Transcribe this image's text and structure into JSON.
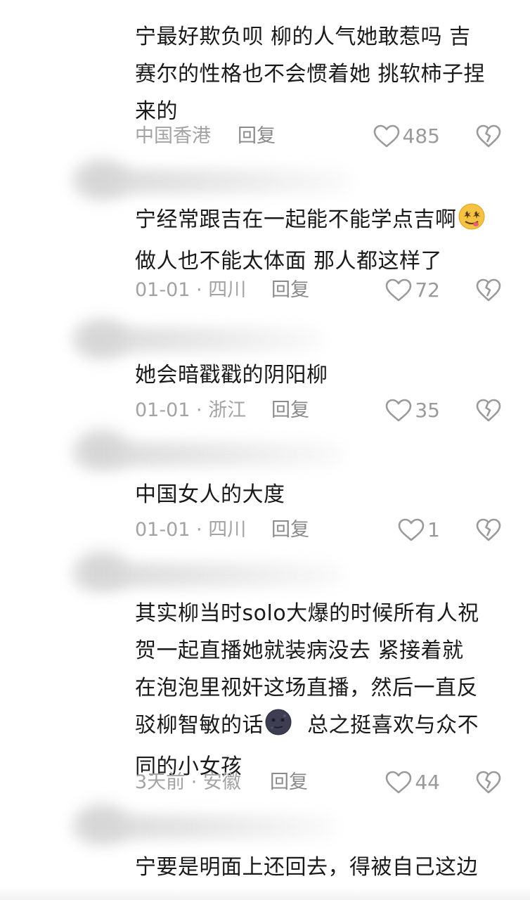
{
  "comments": [
    {
      "lines": [
        "宁最好欺负呗 柳的人气她敢惹吗 吉",
        "赛尔的性格也不会惯着她 挑软柿子捏",
        "来的"
      ],
      "meta": "中国香港",
      "reply": "回复",
      "likes": "485"
    },
    {
      "lines": [
        "宁经常跟吉在一起能不能学点吉啊",
        "做人也不能太体面 那人都这样了"
      ],
      "emoji": "drooling-face-icon",
      "meta": "01-01 · 四川",
      "reply": "回复",
      "likes": "72"
    },
    {
      "lines": [
        "她会暗戳戳的阴阳柳"
      ],
      "meta": "01-01 · 浙江",
      "reply": "回复",
      "likes": "35"
    },
    {
      "lines": [
        "中国女人的大度"
      ],
      "meta": "01-01 · 四川",
      "reply": "回复",
      "likes": "1"
    },
    {
      "lines": [
        "其实柳当时solo大爆的时候所有人祝",
        "贺一起直播她就装病没去  紧接着就",
        "在泡泡里视奸这场直播，然后一直反",
        "驳柳智敏的话",
        "同的小女孩"
      ],
      "line4_suffix": "  总之挺喜欢与众不",
      "emoji": "new-moon-face-icon",
      "meta": "3天前 · 安徽",
      "reply": "回复",
      "likes": "44"
    },
    {
      "lines": [
        "宁要是明面上还回去，得被自己这边"
      ]
    }
  ],
  "icons": {
    "like": "heart-outline-icon",
    "dislike": "broken-heart-icon"
  },
  "colors": {
    "text": "#1a1a1a",
    "meta": "#a3a3a3",
    "icon": "#9a9a9a"
  }
}
